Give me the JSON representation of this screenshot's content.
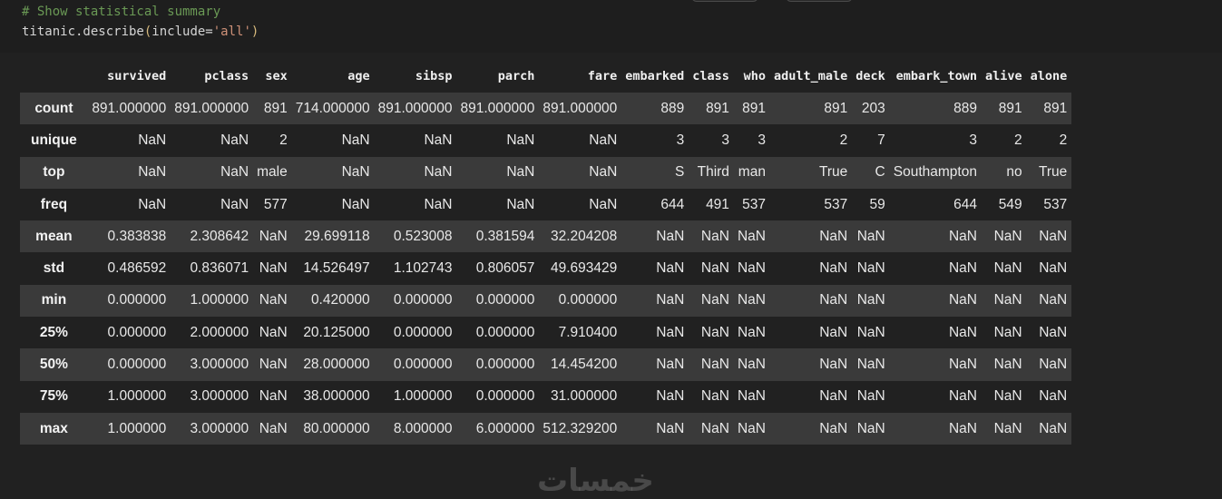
{
  "code": {
    "comment": "# Show statistical summary",
    "call_prefix": "titanic.describe",
    "open_paren": "(",
    "arg_name": "include=",
    "arg_value": "'all'",
    "close_paren": ")"
  },
  "table": {
    "columns": [
      "survived",
      "pclass",
      "sex",
      "age",
      "sibsp",
      "parch",
      "fare",
      "embarked",
      "class",
      "who",
      "adult_male",
      "deck",
      "embark_town",
      "alive",
      "alone"
    ],
    "rows": [
      {
        "label": "count",
        "cells": [
          "891.000000",
          "891.000000",
          "891",
          "714.000000",
          "891.000000",
          "891.000000",
          "891.000000",
          "889",
          "891",
          "891",
          "891",
          "203",
          "889",
          "891",
          "891"
        ]
      },
      {
        "label": "unique",
        "cells": [
          "NaN",
          "NaN",
          "2",
          "NaN",
          "NaN",
          "NaN",
          "NaN",
          "3",
          "3",
          "3",
          "2",
          "7",
          "3",
          "2",
          "2"
        ]
      },
      {
        "label": "top",
        "cells": [
          "NaN",
          "NaN",
          "male",
          "NaN",
          "NaN",
          "NaN",
          "NaN",
          "S",
          "Third",
          "man",
          "True",
          "C",
          "Southampton",
          "no",
          "True"
        ]
      },
      {
        "label": "freq",
        "cells": [
          "NaN",
          "NaN",
          "577",
          "NaN",
          "NaN",
          "NaN",
          "NaN",
          "644",
          "491",
          "537",
          "537",
          "59",
          "644",
          "549",
          "537"
        ]
      },
      {
        "label": "mean",
        "cells": [
          "0.383838",
          "2.308642",
          "NaN",
          "29.699118",
          "0.523008",
          "0.381594",
          "32.204208",
          "NaN",
          "NaN",
          "NaN",
          "NaN",
          "NaN",
          "NaN",
          "NaN",
          "NaN"
        ]
      },
      {
        "label": "std",
        "cells": [
          "0.486592",
          "0.836071",
          "NaN",
          "14.526497",
          "1.102743",
          "0.806057",
          "49.693429",
          "NaN",
          "NaN",
          "NaN",
          "NaN",
          "NaN",
          "NaN",
          "NaN",
          "NaN"
        ]
      },
      {
        "label": "min",
        "cells": [
          "0.000000",
          "1.000000",
          "NaN",
          "0.420000",
          "0.000000",
          "0.000000",
          "0.000000",
          "NaN",
          "NaN",
          "NaN",
          "NaN",
          "NaN",
          "NaN",
          "NaN",
          "NaN"
        ]
      },
      {
        "label": "25%",
        "cells": [
          "0.000000",
          "2.000000",
          "NaN",
          "20.125000",
          "0.000000",
          "0.000000",
          "7.910400",
          "NaN",
          "NaN",
          "NaN",
          "NaN",
          "NaN",
          "NaN",
          "NaN",
          "NaN"
        ]
      },
      {
        "label": "50%",
        "cells": [
          "0.000000",
          "3.000000",
          "NaN",
          "28.000000",
          "0.000000",
          "0.000000",
          "14.454200",
          "NaN",
          "NaN",
          "NaN",
          "NaN",
          "NaN",
          "NaN",
          "NaN",
          "NaN"
        ]
      },
      {
        "label": "75%",
        "cells": [
          "1.000000",
          "3.000000",
          "NaN",
          "38.000000",
          "1.000000",
          "0.000000",
          "31.000000",
          "NaN",
          "NaN",
          "NaN",
          "NaN",
          "NaN",
          "NaN",
          "NaN",
          "NaN"
        ]
      },
      {
        "label": "max",
        "cells": [
          "1.000000",
          "3.000000",
          "NaN",
          "80.000000",
          "8.000000",
          "6.000000",
          "512.329200",
          "NaN",
          "NaN",
          "NaN",
          "NaN",
          "NaN",
          "NaN",
          "NaN",
          "NaN"
        ]
      }
    ]
  },
  "watermark": "خمسات",
  "colors": {
    "background": "#212121",
    "row_stripe": "#3a3a3a",
    "comment": "#6a9955",
    "string": "#ce9178"
  }
}
